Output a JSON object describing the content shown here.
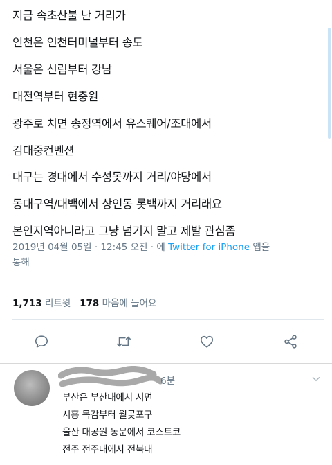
{
  "tweet": {
    "lines": [
      "지금 속초산불 난 거리가",
      "인천은 인천터미널부터 송도",
      "서울은 신림부터 강남",
      "대전역부터 현충원",
      "광주로 치면 송정역에서 유스퀘어/조대에서",
      "김대중컨벤션",
      "대구는 경대에서 수성못까지 거리/야당에서",
      "동대구역/대백에서 상인동 롯백까지 거리래요",
      "본인지역아니라고 그냥 넘기지 말고 제발 관심좀"
    ],
    "timestamp": "2019년 04월 05일 · 12:45 오전 · 에",
    "source": "Twitter for iPhone",
    "source_suffix": "앱을",
    "source_suffix2": "통해",
    "retweet_count": "1,713",
    "retweet_label": "리트윗",
    "like_count": "178",
    "like_label": "마음에 들어요"
  },
  "actions": {
    "reply_icon": "reply-icon",
    "retweet_icon": "retweet-icon",
    "like_icon": "heart-icon",
    "share_icon": "share-icon"
  },
  "reply": {
    "time": "6분",
    "lines": [
      "부산은 부산대에서 서면",
      "시흥 목감부터 월곶포구",
      "울산 대공원 동문에서 코스트코",
      "전주 전주대에서 전북대"
    ]
  },
  "colors": {
    "link": "#1da1f2",
    "muted": "#657786",
    "text": "#14171a"
  }
}
